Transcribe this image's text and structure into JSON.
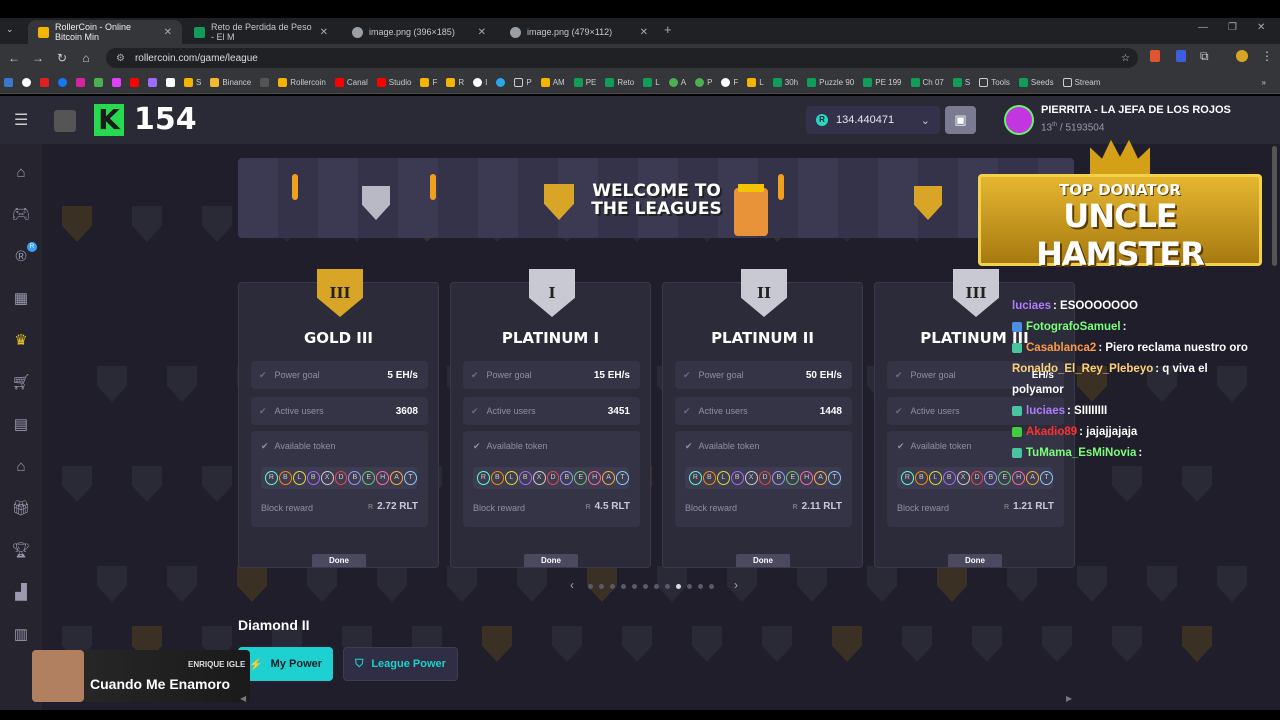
{
  "browser": {
    "tabs": [
      {
        "title": "RollerCoin - Online Bitcoin Min",
        "color": "#f4b400"
      },
      {
        "title": "Reto de Perdida de Peso - El M",
        "color": "#0f9d58"
      },
      {
        "title": "image.png (396×185)",
        "color": "#9aa0a6"
      },
      {
        "title": "image.png (479×112)",
        "color": "#9aa0a6"
      }
    ],
    "url": "rollercoin.com/game/league",
    "bookmarks": [
      "S",
      "Binance",
      "Rollercoin",
      "Canal",
      "Studio",
      "F",
      "R",
      "I",
      "P",
      "AM",
      "PE",
      "Reto",
      "L",
      "A",
      "P",
      "F",
      "L",
      "30h",
      "Puzzle 90",
      "PE 199",
      "Ch 07",
      "S",
      "Tools",
      "Seeds",
      "Stream"
    ]
  },
  "header": {
    "level": "154",
    "balance": "134.440471",
    "username": "PIERRITA - LA JEFA DE LOS ROJOS",
    "rank": "13",
    "rank_suffix": "th",
    "rank_total": "/ 5193504"
  },
  "banner": {
    "line1": "WELCOME TO",
    "line2": "THE LEAGUES"
  },
  "overlay": {
    "top_donator": "TOP DONATOR",
    "donator_name": "UNCLE HAMSTER"
  },
  "leagues": [
    {
      "name": "GOLD III",
      "numeral": "III",
      "power_goal": "5 EH/s",
      "active_users": "3608",
      "block_reward": "2.72 RLT",
      "badge_color": "#d9a526"
    },
    {
      "name": "PLATINUM I",
      "numeral": "I",
      "power_goal": "15 EH/s",
      "active_users": "3451",
      "block_reward": "4.5 RLT",
      "badge_color": "#c9c9d4"
    },
    {
      "name": "PLATINUM II",
      "numeral": "II",
      "power_goal": "50 EH/s",
      "active_users": "1448",
      "block_reward": "2.11 RLT",
      "badge_color": "#c9c9d4"
    },
    {
      "name": "PLATINUM III",
      "numeral": "III",
      "power_goal": "EH/s",
      "active_users": "",
      "block_reward": "1.21 RLT",
      "badge_color": "#c9c9d4"
    }
  ],
  "labels": {
    "power_goal": "Power goal",
    "active_users": "Active users",
    "available_token": "Available token",
    "block_reward": "Block reward",
    "done": "Done"
  },
  "current_league": "Diamond II",
  "buttons": {
    "my_power": "My Power",
    "league_power": "League Power"
  },
  "music": {
    "artist": "ENRIQUE IGLE",
    "song": "Cuando Me Enamoro"
  },
  "chat": [
    {
      "user": "luciaes",
      "msg": ": ESOOOOOOO",
      "color": "#b07bff",
      "badge": ""
    },
    {
      "user": "FotografoSamuel",
      "msg": ":",
      "color": "#7bff7b",
      "badge": "#4a90e2"
    },
    {
      "user": "Casablanca2",
      "msg": ": Piero reclama nuestro oro",
      "color": "#ff9a4a",
      "badge": "#4ac4a0"
    },
    {
      "user": "Ronaldo_El_Rey_Plebeyo",
      "msg": ": q viva el polyamor",
      "color": "#ffd27a",
      "badge": ""
    },
    {
      "user": "luciaes",
      "msg": ": SIIIIIIII",
      "color": "#b07bff",
      "badge": "#4ac4a0"
    },
    {
      "user": "Akadio89",
      "msg": ": jajajjajaja",
      "color": "#ff3030",
      "badge": "#3ecf3e"
    },
    {
      "user": "TuMama_EsMiNovia",
      "msg": ":",
      "color": "#7bff7b",
      "badge": "#4ac4a0"
    }
  ],
  "pagination": {
    "pages": 12,
    "active": 9
  }
}
